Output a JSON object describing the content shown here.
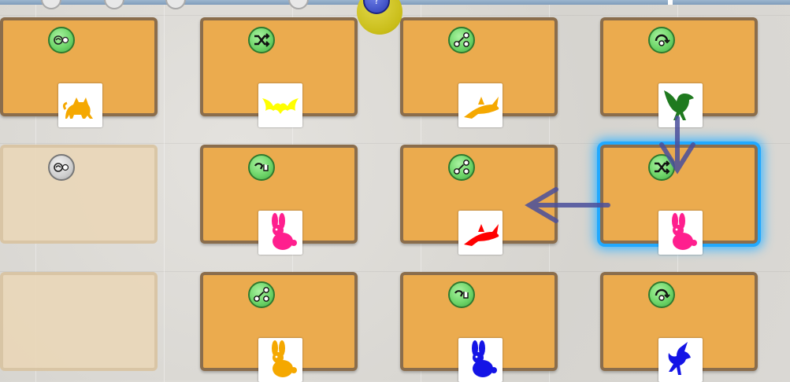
{
  "board": {
    "top_piece_label": "?",
    "colors": {
      "card": "#ebab4e",
      "card_border": "#8a6d4c",
      "empty": "#ead7b9",
      "highlight": "#21a9ff",
      "token": "#6fd66a",
      "arrow": "#4a4f9c"
    }
  },
  "cards": [
    {
      "id": "r1c1",
      "state": "filled",
      "token": "swap-icon",
      "animal": "cat-icon",
      "animal_color": "#f5a800"
    },
    {
      "id": "r1c2",
      "state": "filled",
      "token": "shuffle-icon",
      "animal": "bat-icon",
      "animal_color": "#ffff00"
    },
    {
      "id": "r1c3",
      "state": "filled",
      "token": "branch-icon",
      "animal": "shark-icon",
      "animal_color": "#f5a800"
    },
    {
      "id": "r1c4",
      "state": "filled",
      "token": "rotate-icon",
      "animal": "eagle-icon",
      "animal_color": "#1f7a1f"
    },
    {
      "id": "r2c1",
      "state": "empty",
      "token": "swap-icon",
      "animal": null
    },
    {
      "id": "r2c2",
      "state": "filled",
      "token": "hand-turn-icon",
      "animal": "rabbit-icon",
      "animal_color": "#ff1f8e"
    },
    {
      "id": "r2c3",
      "state": "filled",
      "token": "branch-icon",
      "animal": "shark-icon",
      "animal_color": "#ff0000"
    },
    {
      "id": "r2c4",
      "state": "filled",
      "selected": true,
      "token": "shuffle-icon",
      "animal": "rabbit-icon",
      "animal_color": "#ff1f8e"
    },
    {
      "id": "r3c1",
      "state": "empty",
      "token": null,
      "animal": null
    },
    {
      "id": "r3c2",
      "state": "filled",
      "token": "branch-icon",
      "animal": "rabbit-icon",
      "animal_color": "#f5a800"
    },
    {
      "id": "r3c3",
      "state": "filled",
      "token": "hand-turn-icon",
      "animal": "rabbit-icon",
      "animal_color": "#1414e6"
    },
    {
      "id": "r3c4",
      "state": "filled",
      "token": "rotate-icon",
      "animal": "unicorn-icon",
      "animal_color": "#1414e6"
    }
  ]
}
